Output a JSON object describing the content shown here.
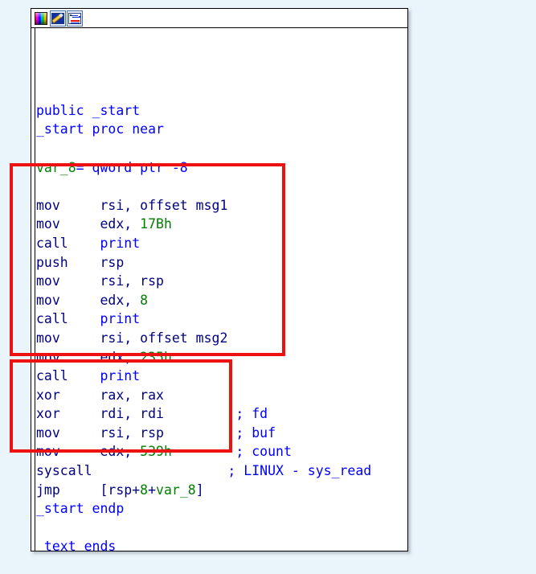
{
  "window": {
    "title": "",
    "background_color": "#e9f4fb",
    "panel_color": "#ffffff"
  },
  "toolbar": {
    "buttons": [
      {
        "name": "color-palette-icon",
        "label": "Color palette",
        "framed": false
      },
      {
        "name": "edit-pencil-icon",
        "label": "Edit",
        "framed": true
      },
      {
        "name": "graph-view-icon",
        "label": "Graph view",
        "framed": true
      }
    ]
  },
  "colors": {
    "mnemonic": "#000080",
    "operand": "#000080",
    "symbol": "#0000ff",
    "comment": "#0000ff",
    "number": "#008000",
    "variable": "#008000",
    "annotation": "#ee1111"
  },
  "listing": {
    "lines": [
      {
        "tokens": []
      },
      {
        "tokens": []
      },
      {
        "tokens": []
      },
      {
        "tokens": [
          {
            "t": "public _start",
            "c": "blue"
          }
        ]
      },
      {
        "tokens": [
          {
            "t": "_start proc near",
            "c": "blue"
          }
        ]
      },
      {
        "tokens": []
      },
      {
        "tokens": [
          {
            "t": "var_8",
            "c": "green"
          },
          {
            "t": "= qword ptr -8",
            "c": "blue"
          }
        ]
      },
      {
        "tokens": []
      },
      {
        "tokens": [
          {
            "t": "mov     rsi, offset msg1",
            "c": "navy"
          }
        ]
      },
      {
        "tokens": [
          {
            "t": "mov     edx, ",
            "c": "navy"
          },
          {
            "t": "17Bh",
            "c": "green"
          }
        ]
      },
      {
        "tokens": [
          {
            "t": "call    ",
            "c": "navy"
          },
          {
            "t": "print",
            "c": "blue"
          }
        ]
      },
      {
        "tokens": [
          {
            "t": "push    rsp",
            "c": "navy"
          }
        ]
      },
      {
        "tokens": [
          {
            "t": "mov     rsi, rsp",
            "c": "navy"
          }
        ]
      },
      {
        "tokens": [
          {
            "t": "mov     edx, ",
            "c": "navy"
          },
          {
            "t": "8",
            "c": "green"
          }
        ]
      },
      {
        "tokens": [
          {
            "t": "call    ",
            "c": "navy"
          },
          {
            "t": "print",
            "c": "blue"
          }
        ]
      },
      {
        "tokens": [
          {
            "t": "mov     rsi, offset msg2",
            "c": "navy"
          }
        ]
      },
      {
        "tokens": [
          {
            "t": "mov     edx, ",
            "c": "navy"
          },
          {
            "t": "235h",
            "c": "green"
          }
        ]
      },
      {
        "tokens": [
          {
            "t": "call    ",
            "c": "navy"
          },
          {
            "t": "print",
            "c": "blue"
          }
        ]
      },
      {
        "tokens": [
          {
            "t": "xor     rax, rax",
            "c": "navy"
          }
        ]
      },
      {
        "tokens": [
          {
            "t": "xor     rdi, rdi",
            "c": "navy"
          },
          {
            "t": "         ; fd",
            "c": "blue"
          }
        ]
      },
      {
        "tokens": [
          {
            "t": "mov     rsi, rsp",
            "c": "navy"
          },
          {
            "t": "         ; buf",
            "c": "blue"
          }
        ]
      },
      {
        "tokens": [
          {
            "t": "mov     edx, ",
            "c": "navy"
          },
          {
            "t": "539h",
            "c": "green"
          },
          {
            "t": "        ; count",
            "c": "blue"
          }
        ]
      },
      {
        "tokens": [
          {
            "t": "syscall",
            "c": "navy"
          },
          {
            "t": "                 ; LINUX - sys_read",
            "c": "blue"
          }
        ]
      },
      {
        "tokens": [
          {
            "t": "jmp     [rsp+",
            "c": "navy"
          },
          {
            "t": "8",
            "c": "green"
          },
          {
            "t": "+",
            "c": "navy"
          },
          {
            "t": "var_8",
            "c": "green"
          },
          {
            "t": "]",
            "c": "navy"
          }
        ]
      },
      {
        "tokens": [
          {
            "t": "_start endp",
            "c": "blue"
          }
        ]
      },
      {
        "tokens": []
      },
      {
        "tokens": [
          {
            "t": "_text ends",
            "c": "blue"
          }
        ]
      }
    ]
  },
  "annotations": [
    {
      "name": "annot-print-block",
      "label": "print calls block highlight",
      "covers": "mov rsi, offset msg1 ... call print",
      "color": "#ee1111"
    },
    {
      "name": "annot-sysread-block",
      "label": "sys_read block highlight",
      "covers": "xor rax, rax ... syscall",
      "color": "#ee1111"
    }
  ]
}
